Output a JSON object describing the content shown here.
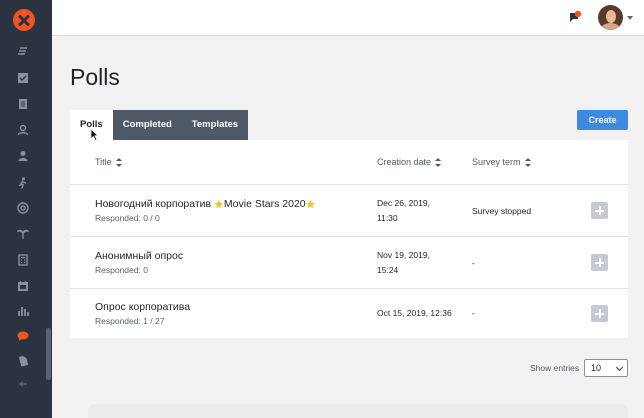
{
  "app": {
    "accent_color": "#f05423",
    "primary_color": "#3d8ae0"
  },
  "sidebar": {
    "icons": [
      "menu-lines-icon",
      "checkbox-icon",
      "document-icon",
      "user-circle-icon",
      "user-icon",
      "person-icon",
      "target-icon",
      "palm-tree-icon",
      "calculator-icon",
      "calendar-icon",
      "bar-chart-icon",
      "chat-bubble-icon",
      "file-icon",
      "collapse-arrow-icon"
    ],
    "active_icon": "chat-bubble-icon"
  },
  "topbar": {
    "chat_icon": "chat-icon",
    "avatar_icon": "avatar"
  },
  "page": {
    "title": "Polls"
  },
  "tabs": [
    {
      "label": "Polls",
      "active": true
    },
    {
      "label": "Completed",
      "active": false
    },
    {
      "label": "Templates",
      "active": false
    }
  ],
  "actions": {
    "create_label": "Create"
  },
  "table": {
    "columns": [
      "Title",
      "Creation date",
      "Survey term"
    ],
    "rows": [
      {
        "title_before": "Новогодний корпоратив ",
        "title_mid": "Movie Stars 2020",
        "responded": "Responded: 0 / 0",
        "date_line1": "Dec 26, 2019,",
        "date_line2": "11:30",
        "term": "Survey stopped"
      },
      {
        "title": "Анонимный опрос",
        "responded": "Responded: 0",
        "date_line1": "Nov 19, 2019,",
        "date_line2": "15:24",
        "term": "-"
      },
      {
        "title": "Опрос корпоратива",
        "responded": "Responded: 1 / 27",
        "date_line1": "Oct 15, 2019, 12:36",
        "date_line2": "",
        "term": "-"
      }
    ]
  },
  "footer": {
    "show_entries_label": "Show entries",
    "entries_value": "10"
  }
}
